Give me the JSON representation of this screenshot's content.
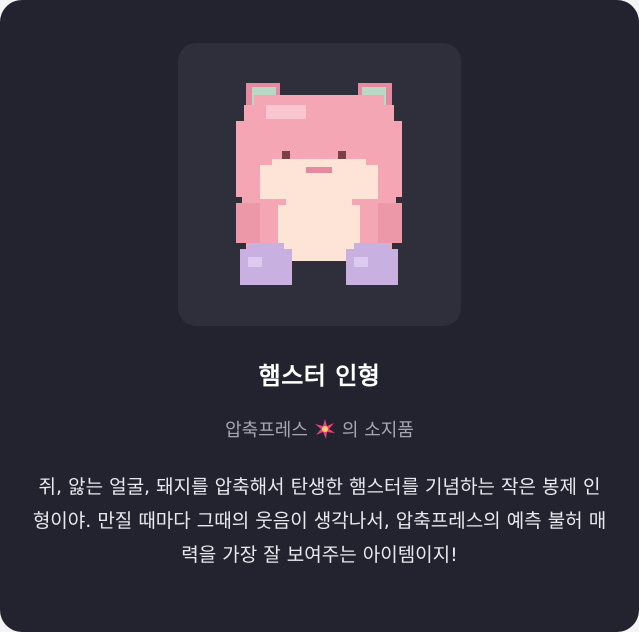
{
  "item": {
    "image_icon": "pixel-hamster-plush",
    "title": "햄스터 인형",
    "owner": "압축프레스",
    "owner_suffix": "의 소지품",
    "owner_icon": "sparkle-icon",
    "description": "쥐, 앓는 얼굴, 돼지를 압축해서 탄생한 햄스터를 기념하는 작은 봉제 인형이야. 만질 때마다 그때의 웃음이 생각나서, 압축프레스의 예측 불허 매력을 가장 잘 보여주는 아이템이지!"
  },
  "colors": {
    "card_bg": "#23232f",
    "frame_bg": "#2f2f3b",
    "title": "#ffffff",
    "subtitle": "#a6a6b0",
    "body": "#e8e8ee",
    "hamster_pink": "#f4a6b4",
    "hamster_belly": "#fde4d6",
    "ear_mint": "#b9d9c4",
    "feet_lavender": "#c8b0e0"
  }
}
